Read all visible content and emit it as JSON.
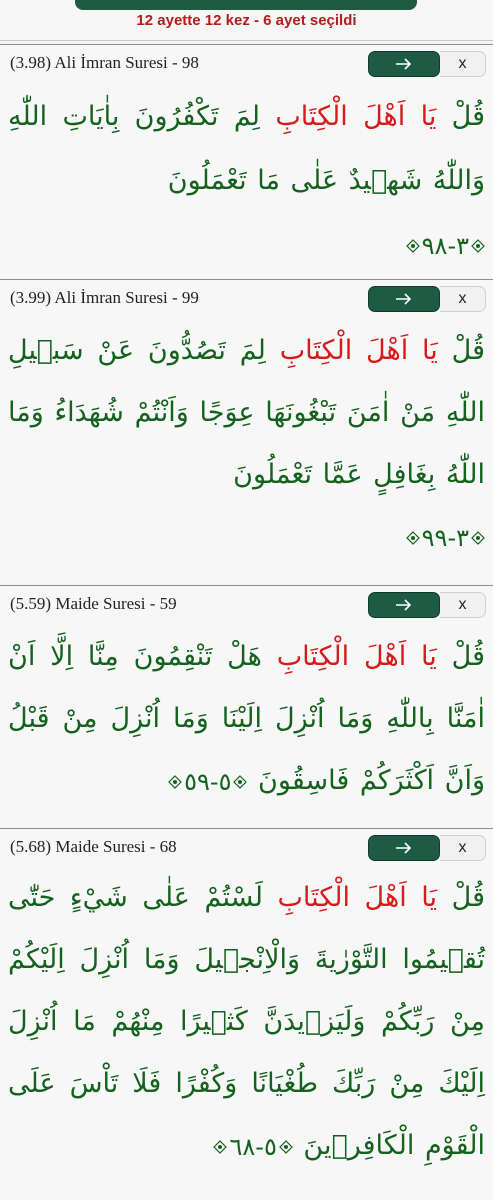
{
  "summary": "12 ayette 12 kez - 6 ayet seçildi",
  "colors": {
    "accent": "#1f5a45",
    "highlight": "#d51b1b",
    "verse_text": "#15621f",
    "summary_text": "#b51c1c"
  },
  "controls": {
    "go_icon": "arrow-right-icon",
    "close_label": "x"
  },
  "cards": [
    {
      "title": "(3.98) Ali İmran Suresi - 98",
      "highlight": "يَا اَهْلَ الْكِتَابِ",
      "before": "قُلْ ",
      "after": " لِمَ تَكْفُرُونَ بِاٰيَاتِ اللّٰهِ وَاللّٰهُ شَهٖيدٌ عَلٰى مَا تَعْمَلُونَ",
      "verse_number": "٣-٩٨"
    },
    {
      "title": "(3.99) Ali İmran Suresi - 99",
      "highlight": "يَا اَهْلَ الْكِتَابِ",
      "before": "قُلْ ",
      "after": " لِمَ تَصُدُّونَ عَنْ سَبٖيلِ اللّٰهِ مَنْ اٰمَنَ تَبْغُونَهَا عِوَجًا وَاَنْتُمْ شُهَدَاءُ وَمَا اللّٰهُ بِغَافِلٍ عَمَّا تَعْمَلُونَ",
      "verse_number": "٣-٩٩"
    },
    {
      "title": "(5.59) Maide Suresi - 59",
      "highlight": "يَا اَهْلَ الْكِتَابِ",
      "before": "قُلْ ",
      "after": " هَلْ تَنْقِمُونَ مِنَّا اِلَّا اَنْ اٰمَنَّا بِاللّٰهِ وَمَا اُنْزِلَ اِلَيْنَا وَمَا اُنْزِلَ مِنْ قَبْلُ وَاَنَّ اَكْثَرَكُمْ فَاسِقُونَ",
      "verse_number": "٥-٥٩"
    },
    {
      "title": "(5.68) Maide Suresi - 68",
      "highlight": "يَا اَهْلَ الْكِتَابِ",
      "before": "قُلْ ",
      "after": " لَسْتُمْ عَلٰى شَيْءٍ حَتّٰى تُقٖيمُوا التَّوْرٰيةَ وَالْاِنْجٖيلَ وَمَا اُنْزِلَ اِلَيْكُمْ مِنْ رَبِّكُمْ وَلَيَزٖيدَنَّ كَثٖيرًا مِنْهُمْ مَا اُنْزِلَ اِلَيْكَ مِنْ رَبِّكَ طُغْيَانًا وَكُفْرًا فَلَا تَاْسَ عَلَى الْقَوْمِ الْكَافِرٖينَ",
      "verse_number": "٥-٦٨"
    }
  ]
}
